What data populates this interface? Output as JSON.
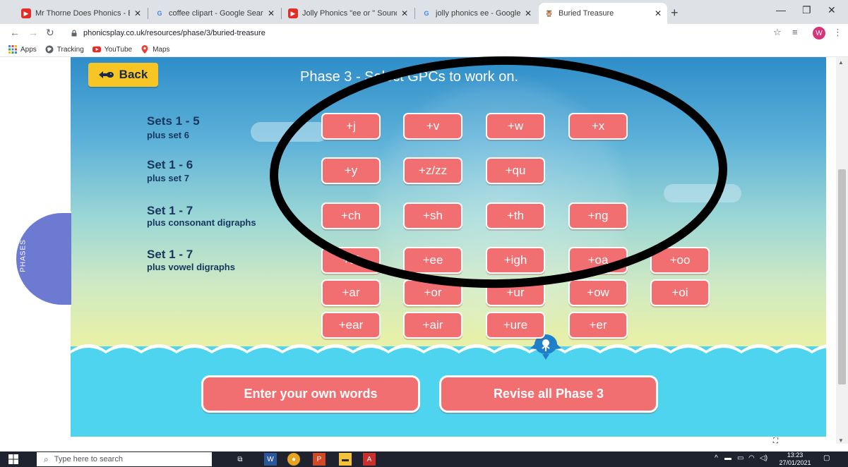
{
  "browser": {
    "tabs": [
      {
        "title": "Mr Thorne Does Phonics - Episo",
        "favicon": "youtube-icon"
      },
      {
        "title": "coffee clipart - Google Search",
        "favicon": "google-icon"
      },
      {
        "title": "Jolly Phonics \"ee or \" Sounds - Yo",
        "favicon": "youtube-icon"
      },
      {
        "title": "jolly phonics ee - Google Search",
        "favicon": "google-icon"
      },
      {
        "title": "Buried Treasure",
        "favicon": "owl-icon",
        "active": true
      }
    ],
    "url": "phonicsplay.co.uk/resources/phase/3/buried-treasure",
    "profile_initial": "W",
    "bookmarks": [
      {
        "label": "Apps",
        "icon": "apps-grid-icon"
      },
      {
        "label": "Tracking",
        "icon": "globe-icon"
      },
      {
        "label": "YouTube",
        "icon": "youtube-icon"
      },
      {
        "label": "Maps",
        "icon": "maps-pin-icon"
      }
    ]
  },
  "game": {
    "back_label": "Back",
    "heading": "Phase 3 - Select GPCs to work on.",
    "side_tab": "PHASES",
    "sets": [
      {
        "title": "Sets 1 - 5",
        "subtitle": "plus set 6"
      },
      {
        "title": "Set 1 - 6",
        "subtitle": "plus set 7"
      },
      {
        "title": "Set 1 - 7",
        "subtitle": "plus consonant digraphs"
      },
      {
        "title": "Set 1 - 7",
        "subtitle": "plus vowel digraphs"
      }
    ],
    "gpc_rows": [
      [
        "+j",
        "+v",
        "+w",
        "+x"
      ],
      [
        "+y",
        "+z/zz",
        "+qu"
      ],
      [
        "+ch",
        "+sh",
        "+th",
        "+ng"
      ],
      [
        "+ai",
        "+ee",
        "+igh",
        "+oa",
        "+oo"
      ],
      [
        "+ar",
        "+or",
        "+ur",
        "+ow",
        "+oi"
      ],
      [
        "+ear",
        "+air",
        "+ure",
        "+er"
      ]
    ],
    "enter_words_label": "Enter your own words",
    "revise_label": "Revise all Phase 3"
  },
  "taskbar": {
    "search_placeholder": "Type here to search",
    "time": "13:23",
    "date": "27/01/2021"
  },
  "colors": {
    "button": "#f26f71",
    "back": "#f7c524",
    "set_text": "#17365d",
    "sea": "#4fd4f0"
  }
}
